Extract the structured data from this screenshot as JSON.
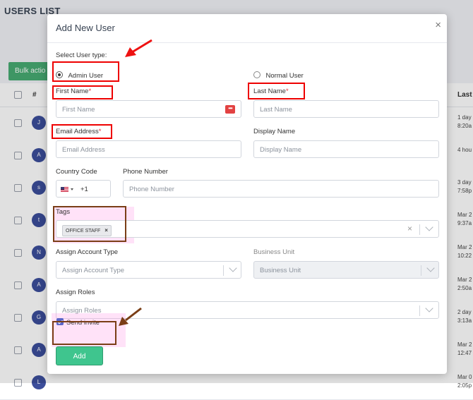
{
  "page": {
    "title": "USERS LIST"
  },
  "background": {
    "bulk_action_label": "Bulk actio",
    "table": {
      "hash_header": "#",
      "last_header": "Last a"
    },
    "rows": [
      {
        "avatar": "J",
        "t1": "1 day",
        "t2": "8:20a"
      },
      {
        "avatar": "A",
        "t1": "4 hou",
        "t2": ""
      },
      {
        "avatar": "s",
        "t1": "3 day",
        "t2": "7:58p"
      },
      {
        "avatar": "t",
        "t1": "Mar 2",
        "t2": "9:37a"
      },
      {
        "avatar": "N",
        "t1": "Mar 2",
        "t2": "10:22"
      },
      {
        "avatar": "A",
        "t1": "Mar 2",
        "t2": "2:50a"
      },
      {
        "avatar": "G",
        "t1": "2 day",
        "t2": "3:13a"
      },
      {
        "avatar": "A",
        "t1": "Mar 2",
        "t2": "12:47"
      },
      {
        "avatar": "L",
        "t1": "Mar 0",
        "t2": "2:05p"
      }
    ]
  },
  "modal": {
    "title": "Add New User",
    "close_icon": "×",
    "user_type_label": "Select User type:",
    "user_types": [
      {
        "label": "Admin User",
        "selected": true
      },
      {
        "label": "Normal User",
        "selected": false
      }
    ],
    "required_mark": "*",
    "first_name": {
      "label": "First Name",
      "placeholder": "First Name",
      "icon": "•••"
    },
    "last_name": {
      "label": "Last Name",
      "placeholder": "Last Name"
    },
    "email": {
      "label": "Email Address",
      "placeholder": "Email Address"
    },
    "display_name": {
      "label": "Display Name",
      "placeholder": "Display Name"
    },
    "country_code": {
      "label": "Country Code",
      "value": "+1",
      "flag_icon": "us-flag-icon"
    },
    "phone": {
      "label": "Phone Number",
      "placeholder": "Phone Number"
    },
    "tags": {
      "label": "Tags",
      "items": [
        "OFFICE STAFF"
      ],
      "remove_symbol": "×",
      "clear_symbol": "×"
    },
    "account_type": {
      "label": "Assign Account Type",
      "placeholder": "Assign Account Type"
    },
    "business_unit": {
      "label": "Business Unit",
      "placeholder": "Business Unit",
      "disabled": true
    },
    "roles": {
      "label": "Assign Roles",
      "placeholder": "Assign Roles"
    },
    "send_invite": {
      "label": "Send invite",
      "checked": true
    },
    "add_button": "Add"
  },
  "colors": {
    "highlight_red": "#ee0000",
    "highlight_brown": "#7a3e16",
    "add_button": "#3fc58e",
    "avatar": "#3c4e9b"
  }
}
